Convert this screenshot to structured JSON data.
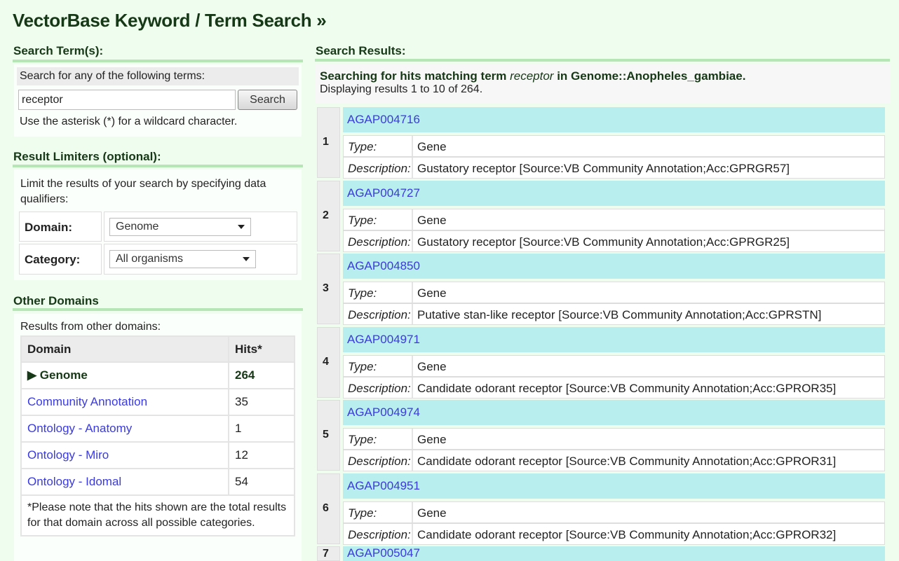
{
  "title": "VectorBase Keyword / Term Search »",
  "search": {
    "heading": "Search Term(s):",
    "prompt": "Search for any of the following terms:",
    "value": "receptor",
    "button": "Search",
    "hint": "Use the asterisk (*) for a wildcard character."
  },
  "limiters": {
    "heading": "Result Limiters (optional):",
    "text": "Limit the results of your search by specifying data qualifiers:",
    "domain_label": "Domain:",
    "domain_value": "Genome",
    "category_label": "Category:",
    "category_value": "All organisms"
  },
  "other": {
    "heading": "Other Domains",
    "intro": "Results from other domains:",
    "col_domain": "Domain",
    "col_hits": "Hits*",
    "rows": [
      {
        "domain": "▶ Genome",
        "hits": "264",
        "current": true
      },
      {
        "domain": "Community Annotation",
        "hits": "35"
      },
      {
        "domain": "Ontology - Anatomy",
        "hits": "1"
      },
      {
        "domain": "Ontology - Miro",
        "hits": "12"
      },
      {
        "domain": "Ontology - Idomal",
        "hits": "54"
      }
    ],
    "note": "*Please note that the hits shown are the total results for that domain across all possible categories."
  },
  "results": {
    "heading": "Search Results:",
    "summary_pre": "Searching for hits matching term ",
    "term": "receptor",
    "summary_post": " in Genome::Anopheles_gambiae.",
    "displaying": "Displaying results 1 to 10 of 264.",
    "type_label": "Type:",
    "desc_label": "Description:",
    "items": [
      {
        "n": "1",
        "id": "AGAP004716",
        "type": "Gene",
        "desc": "Gustatory receptor [Source:VB Community Annotation;Acc:GPRGR57]"
      },
      {
        "n": "2",
        "id": "AGAP004727",
        "type": "Gene",
        "desc": "Gustatory receptor [Source:VB Community Annotation;Acc:GPRGR25]"
      },
      {
        "n": "3",
        "id": "AGAP004850",
        "type": "Gene",
        "desc": "Putative stan-like receptor [Source:VB Community Annotation;Acc:GPRSTN]"
      },
      {
        "n": "4",
        "id": "AGAP004971",
        "type": "Gene",
        "desc": "Candidate odorant receptor [Source:VB Community Annotation;Acc:GPROR35]"
      },
      {
        "n": "5",
        "id": "AGAP004974",
        "type": "Gene",
        "desc": "Candidate odorant receptor [Source:VB Community Annotation;Acc:GPROR31]"
      },
      {
        "n": "6",
        "id": "AGAP004951",
        "type": "Gene",
        "desc": "Candidate odorant receptor [Source:VB Community Annotation;Acc:GPROR32]"
      },
      {
        "n": "7",
        "id": "AGAP005047",
        "type": "",
        "desc": ""
      }
    ]
  }
}
